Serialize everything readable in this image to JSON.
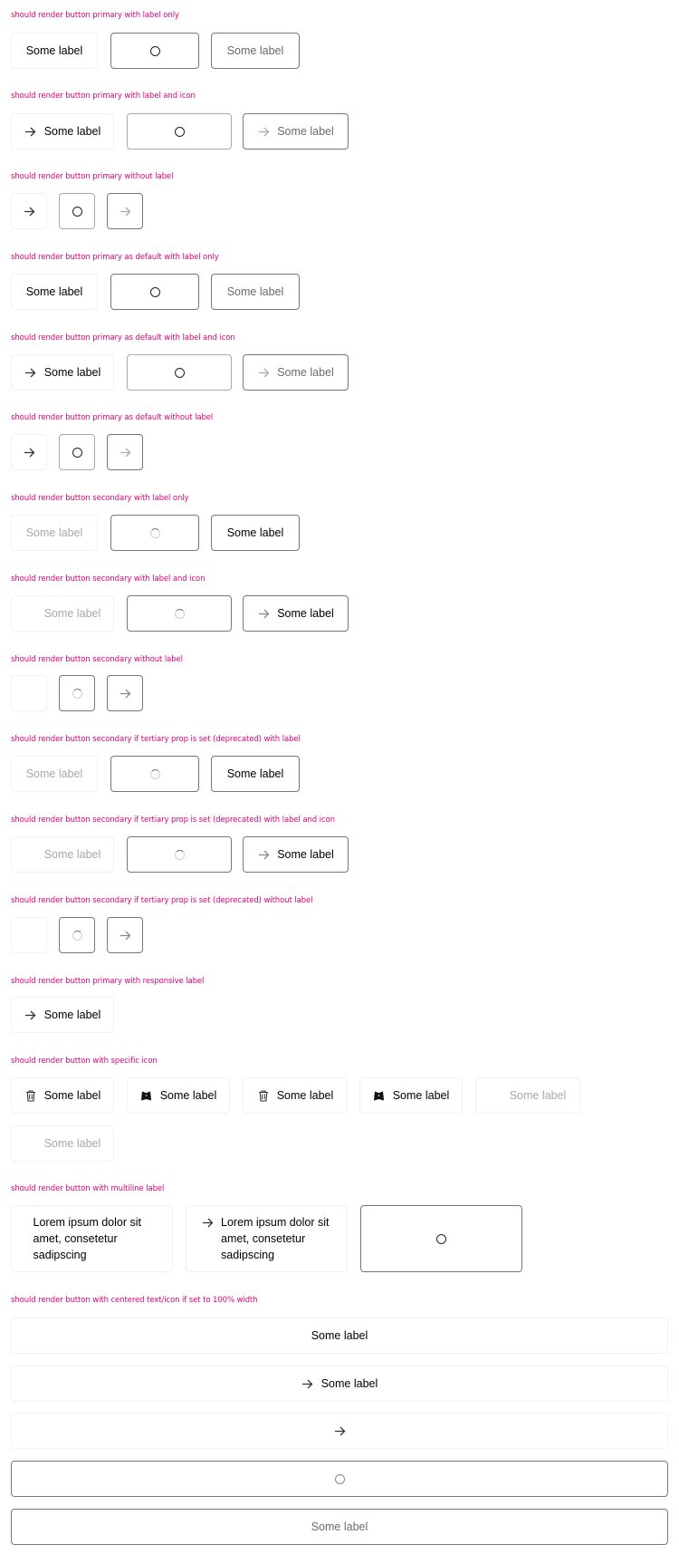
{
  "captions": {
    "c1": "should render button primary with label only",
    "c2": "should render button primary with label and icon",
    "c3": "should render button primary without label",
    "c4": "should render button primary as default with label only",
    "c5": "should render button primary as default with label and icon",
    "c6": "should render button primary as default without label",
    "c7": "should render button secondary with label only",
    "c8": "should render button secondary with label and icon",
    "c9": "should render button secondary without label",
    "c10": "should render button secondary if tertiary prop is set (deprecated) with label",
    "c11": "should render button secondary if tertiary prop is set (deprecated) with label and icon",
    "c12": "should render button secondary if tertiary prop is set (deprecated) without label",
    "c13": "should render button primary with responsive label",
    "c14": "should render button with specific icon",
    "c15": "should render button with multiline label",
    "c16": "should render button with centered text/icon if set to 100% width"
  },
  "labels": {
    "some": "Some label",
    "lorem": "Lorem ipsum dolor sit amet, consetetur sadipscing"
  },
  "icons": {
    "arrow": "arrow-right-icon",
    "delete": "delete-icon",
    "highway": "highway-icon",
    "spinner": "spinner-icon"
  },
  "colors": {
    "caption": "#e20074",
    "border_dark": "#777777",
    "label_faint": "#a8a8a8"
  }
}
